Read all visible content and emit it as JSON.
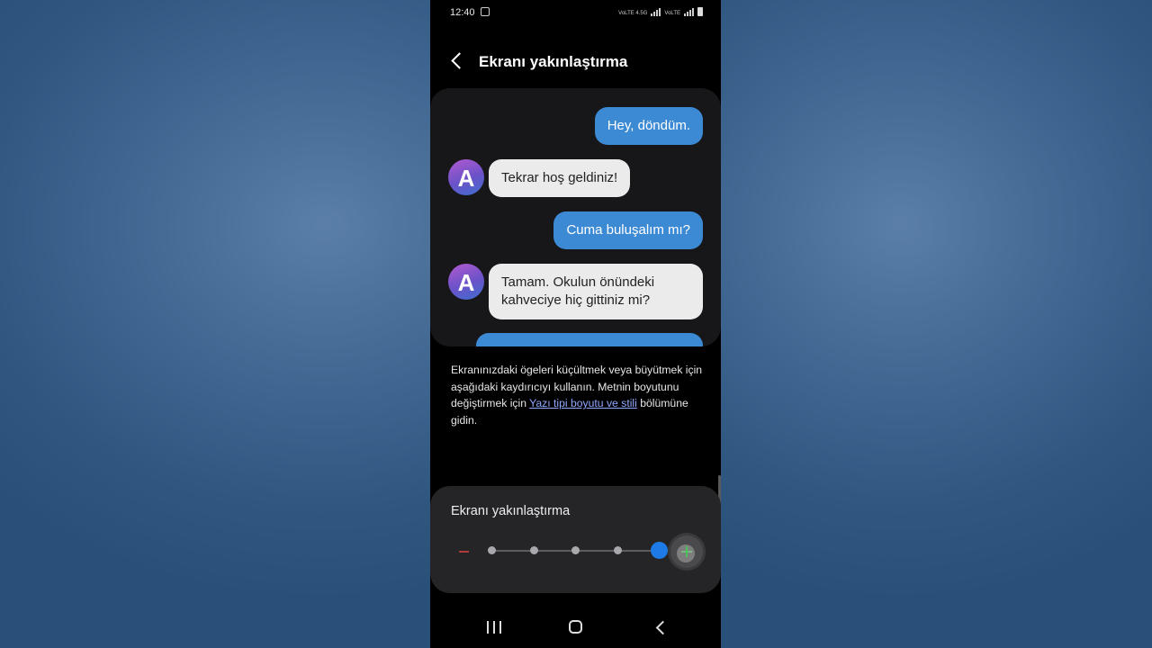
{
  "status_bar": {
    "time": "12:40",
    "signal_text_1": "VoLTE 4.5G",
    "signal_text_2": "VoLTE"
  },
  "header": {
    "title": "Ekranı yakınlaştırma",
    "back_icon": "chevron-left-icon"
  },
  "preview": {
    "messages": [
      {
        "side": "out",
        "text": "Hey, döndüm."
      },
      {
        "side": "in",
        "avatar": "A",
        "text": "Tekrar hoş geldiniz!"
      },
      {
        "side": "out",
        "text": "Cuma buluşalım mı?"
      },
      {
        "side": "in",
        "avatar": "A",
        "text": "Tamam. Okulun önündeki kahveciye hiç gittiniz mi?"
      }
    ]
  },
  "description": {
    "text_before_link": "Ekranınızdaki ögeleri küçültmek veya büyütmek için aşağıdaki kaydırıcıyı kullanın. Metnin boyutunu değiştirmek için ",
    "link_text": "Yazı tipi boyutu ve stili",
    "text_after_link": " bölümüne gidin."
  },
  "zoom": {
    "label": "Ekranı yakınlaştırma",
    "steps": 5,
    "current_step": 5
  },
  "colors": {
    "accent": "#1d7ae6",
    "bubble_out": "#3d8ad4",
    "bubble_in": "#ebebeb",
    "link": "#8fa7ff"
  },
  "nav": {
    "recents_icon": "recents-icon",
    "home_icon": "home-icon",
    "back_icon": "back-icon"
  }
}
